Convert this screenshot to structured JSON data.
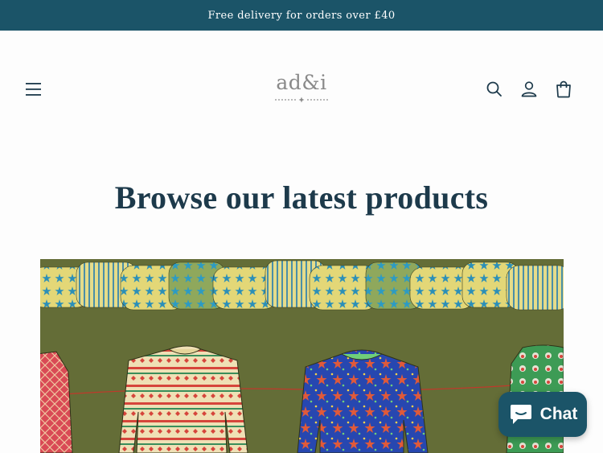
{
  "announcement": {
    "text": "Free delivery for orders over £40"
  },
  "header": {
    "logo_text": "ad&i",
    "icons": [
      "menu-icon",
      "search-icon",
      "account-icon",
      "cart-icon"
    ]
  },
  "main": {
    "heading": "Browse our latest products"
  },
  "hero": {
    "image": "paper-chain-and-christmas-jumper-cutouts"
  },
  "chat": {
    "label": "Chat",
    "icon": "chat-bubble-icon"
  },
  "colors": {
    "brand": "#1b5468",
    "text": "#1d3a4b",
    "logo": "#8a8a8a"
  }
}
